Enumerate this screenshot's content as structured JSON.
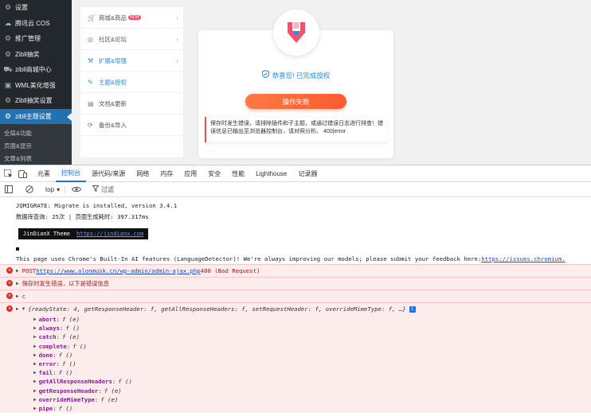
{
  "wp_menu": {
    "items": [
      {
        "label": "设置",
        "icon": "gear-icon",
        "active": false
      },
      {
        "label": "腾讯云 COS",
        "icon": "cloud-icon",
        "active": false
      },
      {
        "label": "推广管理",
        "icon": "gear-icon",
        "active": false
      },
      {
        "label": "Zibll抽奖",
        "icon": "gear-icon",
        "active": false
      },
      {
        "label": "zibll商城中心",
        "icon": "cart-icon",
        "active": false
      },
      {
        "label": "WML美化增强",
        "icon": "window-icon",
        "active": false
      },
      {
        "label": "Zibll抽奖设置",
        "icon": "gear-icon",
        "active": false
      },
      {
        "label": "zibll主题设置",
        "icon": "gear-icon",
        "active": true
      }
    ],
    "sub_items": [
      "全局&功能",
      "页面&显示",
      "文章&列表"
    ]
  },
  "zib_nav": {
    "items": [
      {
        "label": "商城&商品",
        "icon": "cart-icon",
        "badge": "NEW",
        "chevron": true,
        "active": false
      },
      {
        "label": "社区&论坛",
        "icon": "compass-icon",
        "badge": "",
        "chevron": true,
        "active": false
      },
      {
        "label": "扩展&增强",
        "icon": "wrench-icon",
        "badge": "",
        "chevron": true,
        "active": true
      },
      {
        "label": "主题&授权",
        "icon": "bookmark-icon",
        "badge": "",
        "chevron": false,
        "active": true
      },
      {
        "label": "文档&更新",
        "icon": "document-icon",
        "badge": "",
        "chevron": false,
        "active": false
      },
      {
        "label": "备份&导入",
        "icon": "backup-icon",
        "badge": "",
        "chevron": false,
        "active": false
      }
    ]
  },
  "auth_card": {
    "success_text": "恭喜您! 已完成授权",
    "button_label": "操作失败",
    "error_text": "保存时发生错误，请排除插件和子主题，或通过错误日志进行排查！错误信息已输出至浏览器控制台，请对照分析。 400|error"
  },
  "devtools": {
    "tabs": [
      "元素",
      "控制台",
      "源代码/来源",
      "网络",
      "内存",
      "应用",
      "安全",
      "性能",
      "Lighthouse",
      "记录器"
    ],
    "active_tab": "控制台",
    "context": "top",
    "filter_placeholder": "过滤"
  },
  "console": {
    "jqmigrate": "JQMIGRATE: Migrate is installed, version 3.4.1",
    "stats": "数据库查询: 25次 | 页面生成耗时: 397.317ms",
    "badge_title": "JinDianX Theme",
    "badge_link": "https://jindianx.com",
    "ai_notice": "This page uses Chrome's Built-In AI features (LanguageDetector)! We're always improving our models; please submit your feedback here: ",
    "ai_link": "https://issues.chromium.",
    "err_post_prefix": "POST ",
    "err_post_url": "https://www.alonmusk.cn/wp-admin/admin-ajax.php",
    "err_post_status": " 400 (Bad Request)",
    "err_save": "保存时发生错误，以下是错误信息",
    "err_c": "c",
    "obj_summary": "{readyState: 4, getResponseHeader: f, getAllResponseHeaders: f, setRequestHeader: f, overrideMimeType: f, …}",
    "props": [
      {
        "k": "abort",
        "v": "f (e)"
      },
      {
        "k": "always",
        "v": "f ()"
      },
      {
        "k": "catch",
        "v": "f (e)"
      },
      {
        "k": "complete",
        "v": "f ()"
      },
      {
        "k": "done",
        "v": "f ()"
      },
      {
        "k": "error",
        "v": "f ()"
      },
      {
        "k": "fail",
        "v": "f ()"
      },
      {
        "k": "getAllResponseHeaders",
        "v": "f ()"
      },
      {
        "k": "getResponseHeader",
        "v": "f (e)"
      },
      {
        "k": "overrideMimeType",
        "v": "f (e)"
      },
      {
        "k": "pipe",
        "v": "f ()"
      }
    ]
  }
}
